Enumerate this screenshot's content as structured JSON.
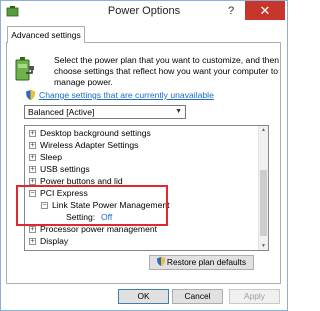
{
  "window": {
    "title": "Power Options",
    "help_glyph": "?",
    "close_glyph": "✕"
  },
  "tab": {
    "label": "Advanced settings"
  },
  "description": "Select the power plan that you want to customize, and then choose settings that reflect how you want your computer to manage power.",
  "change_link": "Change settings that are currently unavailable",
  "plan_select": {
    "value": "Balanced [Active]"
  },
  "tree": {
    "rows": [
      {
        "label": "Desktop background settings",
        "expander": "+"
      },
      {
        "label": "Wireless Adapter Settings",
        "expander": "+"
      },
      {
        "label": "Sleep",
        "expander": "+"
      },
      {
        "label": "USB settings",
        "expander": "+"
      },
      {
        "label": "Power buttons and lid",
        "expander": "+"
      },
      {
        "label": "PCI Express",
        "expander": "−"
      },
      {
        "label": "Link State Power Management",
        "expander": "−"
      },
      {
        "label": "Setting:",
        "value": "Off"
      },
      {
        "label": "Processor power management",
        "expander": "+"
      },
      {
        "label": "Display",
        "expander": "+"
      }
    ]
  },
  "buttons": {
    "restore": "Restore plan defaults",
    "ok": "OK",
    "cancel": "Cancel",
    "apply": "Apply"
  },
  "colors": {
    "link": "#1a6cbf",
    "highlight": "#e0282e",
    "close": "#c7362b"
  },
  "icons": [
    "power-options-icon",
    "battery-plug-icon",
    "uac-shield-icon",
    "help-icon",
    "close-icon",
    "chevron-down-icon"
  ]
}
